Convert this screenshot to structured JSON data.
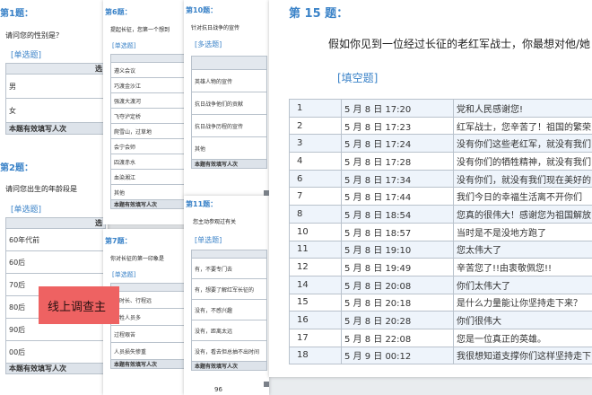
{
  "p1": {
    "q1_title": "第1题：",
    "q1_text": "请问您的性别是？",
    "q1_type": "[单选题]",
    "q1_col": "选",
    "q1_options": [
      "男",
      "女"
    ],
    "q1_footer": "本题有效填写人次",
    "q2_title": "第2题：",
    "q2_text": "请问您出生的年龄段是",
    "q2_type": "[单选题]",
    "q2_col": "选",
    "q2_options": [
      "60年代前",
      "60后",
      "70后",
      "80后",
      "90后",
      "00后"
    ],
    "q2_footer": "本题有效填写人次"
  },
  "overlay": {
    "text": "线上调查主"
  },
  "p2": {
    "title": "第6题：",
    "text": "提起长征，您第一个想到",
    "type": "[单选题]",
    "options": [
      "遵义会议",
      "巧渡金沙江",
      "强渡大渡河",
      "飞夺泸定桥",
      "爬雪山，过草地",
      "会宁会师",
      "四渡赤水",
      "血染湘江",
      "其他"
    ],
    "footer": "本题有效填写人次"
  },
  "p3": {
    "title": "第7题：",
    "text": "你对长征的第一印象是",
    "type": "[单选题]",
    "options": [
      "历时长、行程远",
      "牺牲人员多",
      "过程艰苦",
      "人员损失惨重"
    ],
    "footer": "本题有效填写人次"
  },
  "p4": {
    "title": "第10题：",
    "text": "针对抗日战争的宣传",
    "type": "[多选题]",
    "options": [
      "英雄人物的宣传",
      "抗日战争他们的贡献",
      "抗日战争历程的宣传",
      "其他"
    ],
    "footer": "本题有效填写人次"
  },
  "p5": {
    "title": "第11题：",
    "text": "您主动参观过有关",
    "type": "[单选题]",
    "options": [
      "有，不要专门去",
      "有，想要了解红军长征的",
      "没有，不感兴趣",
      "没有，距离太远",
      "没有，看去但总抽不出时间"
    ],
    "footer": "本题有效填写人次",
    "page_no": "96"
  },
  "p6": {
    "title": "第 15 题：",
    "text": "假如你见到一位经过长征的老红军战士，你最想对他/她",
    "type": "[填空题]",
    "rows": [
      {
        "no": "1",
        "date": "5 月 8 日 17:20",
        "answer": "党和人民感谢您!"
      },
      {
        "no": "2",
        "date": "5 月 8 日 17:23",
        "answer": "红军战士，您辛苦了！祖国的繁荣"
      },
      {
        "no": "3",
        "date": "5 月 8 日 17:24",
        "answer": "没有你们这些老红军，就没有我们"
      },
      {
        "no": "4",
        "date": "5 月 8 日 17:28",
        "answer": "没有你们的牺牲精神，就没有我们"
      },
      {
        "no": "6",
        "date": "5 月 8 日 17:34",
        "answer": "没有你们，就没有我们现在美好的"
      },
      {
        "no": "7",
        "date": "5 月 8 日 17:44",
        "answer": "我们今日的幸福生活离不开你们"
      },
      {
        "no": "8",
        "date": "5 月 8 日 18:54",
        "answer": "您真的很伟大！感谢您为祖国解放"
      },
      {
        "no": "10",
        "date": "5 月 8 日 18:57",
        "answer": "当时是不是没地方跑了"
      },
      {
        "no": "11",
        "date": "5 月 8 日 19:10",
        "answer": "您太伟大了"
      },
      {
        "no": "12",
        "date": "5 月 8 日 19:49",
        "answer": "辛苦您了!!由衷敬佩您!!"
      },
      {
        "no": "14",
        "date": "5 月 8 日 20:08",
        "answer": "你们太伟大了"
      },
      {
        "no": "15",
        "date": "5 月 8 日 20:18",
        "answer": "是什么力量能让你坚持走下来？"
      },
      {
        "no": "16",
        "date": "5 月 8 日 20:28",
        "answer": "你们很伟大"
      },
      {
        "no": "17",
        "date": "5 月 8 日 22:08",
        "answer": "您是一位真正的英雄。"
      },
      {
        "no": "18",
        "date": "5 月 9 日 00:12",
        "answer": "我很想知道支撑你们这样坚持走下"
      }
    ]
  }
}
